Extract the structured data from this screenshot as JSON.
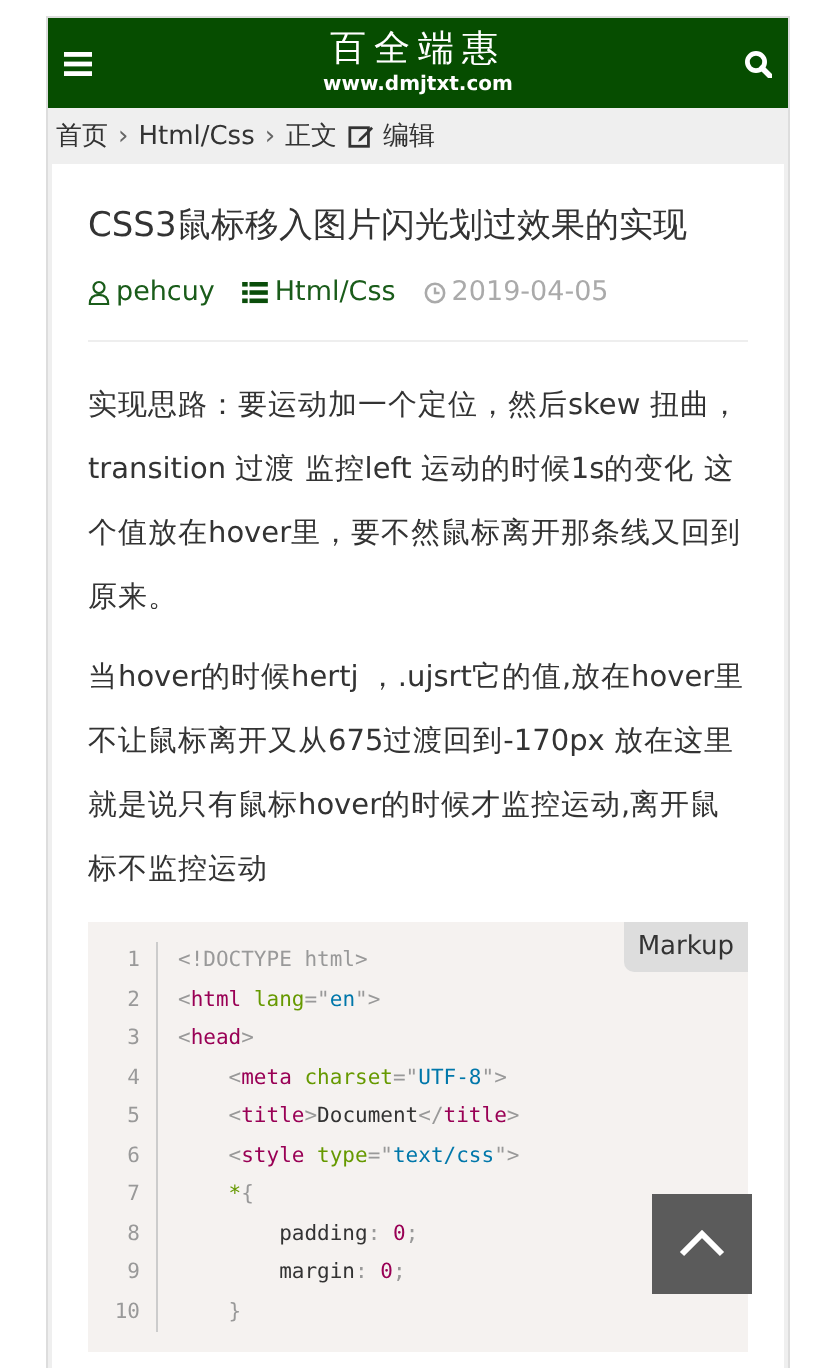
{
  "header": {
    "logo": "百全端惠",
    "domain": "www.dmjtxt.com"
  },
  "breadcrumb": [
    {
      "label": "首页",
      "kind": "link"
    },
    {
      "label": "›",
      "kind": "sep"
    },
    {
      "label": "Html/Css",
      "kind": "link"
    },
    {
      "label": "›",
      "kind": "sep"
    },
    {
      "label": "正文",
      "kind": "text"
    },
    {
      "label": "编辑",
      "kind": "edit"
    }
  ],
  "article": {
    "title": "CSS3鼠标移入图片闪光划过效果的实现",
    "meta": [
      {
        "kind": "author",
        "label": "pehcuy"
      },
      {
        "kind": "category",
        "label": "Html/Css"
      },
      {
        "kind": "date",
        "label": "2019-04-05"
      }
    ],
    "paragraphs": [
      "实现思路：要运动加一个定位，然后skew 扭曲，transition 过渡   监控left 运动的时候1s的变化  这个值放在hover里，要不然鼠标离开那条线又回到原来。",
      "当hover的时候hertj ，.ujsrt它的值,放在hover里不让鼠标离开又从675过渡回到-170px  放在这里就是说只有鼠标hover的时候才监控运动,离开鼠标不监控运动"
    ]
  },
  "code": {
    "language": "Markup",
    "lines": [
      {
        "number": "1",
        "tokens": [
          {
            "kind": "punct",
            "t": "<!DOCTYPE html>"
          }
        ]
      },
      {
        "number": "2",
        "tokens": [
          {
            "kind": "punct",
            "t": "<"
          },
          {
            "kind": "tag",
            "t": "html"
          },
          {
            "kind": "attr",
            "t": " lang"
          },
          {
            "kind": "punct",
            "t": "=\""
          },
          {
            "kind": "str",
            "t": "en"
          },
          {
            "kind": "punct",
            "t": "\">"
          }
        ]
      },
      {
        "number": "3",
        "tokens": [
          {
            "kind": "punct",
            "t": "<"
          },
          {
            "kind": "tag",
            "t": "head"
          },
          {
            "kind": "punct",
            "t": ">"
          }
        ]
      },
      {
        "number": "4",
        "tokens": [
          {
            "kind": "punct",
            "t": "    <"
          },
          {
            "kind": "tag",
            "t": "meta"
          },
          {
            "kind": "attr",
            "t": " charset"
          },
          {
            "kind": "punct",
            "t": "=\""
          },
          {
            "kind": "str",
            "t": "UTF-8"
          },
          {
            "kind": "punct",
            "t": "\">"
          }
        ]
      },
      {
        "number": "5",
        "tokens": [
          {
            "kind": "punct",
            "t": "    <"
          },
          {
            "kind": "tag",
            "t": "title"
          },
          {
            "kind": "punct",
            "t": ">"
          },
          {
            "kind": "plain",
            "t": "Document"
          },
          {
            "kind": "punct",
            "t": "</"
          },
          {
            "kind": "tag",
            "t": "title"
          },
          {
            "kind": "punct",
            "t": ">"
          }
        ]
      },
      {
        "number": "6",
        "tokens": [
          {
            "kind": "punct",
            "t": "    <"
          },
          {
            "kind": "tag",
            "t": "style"
          },
          {
            "kind": "attr",
            "t": " type"
          },
          {
            "kind": "punct",
            "t": "=\""
          },
          {
            "kind": "str",
            "t": "text/css"
          },
          {
            "kind": "punct",
            "t": "\">"
          }
        ]
      },
      {
        "number": "7",
        "tokens": [
          {
            "kind": "sel",
            "t": "    *"
          },
          {
            "kind": "punct",
            "t": "{"
          }
        ]
      },
      {
        "number": "8",
        "tokens": [
          {
            "kind": "plain",
            "t": "        padding"
          },
          {
            "kind": "punct",
            "t": ":"
          },
          {
            "kind": "num",
            "t": " 0"
          },
          {
            "kind": "punct",
            "t": ";"
          }
        ]
      },
      {
        "number": "9",
        "tokens": [
          {
            "kind": "plain",
            "t": "        margin"
          },
          {
            "kind": "punct",
            "t": ":"
          },
          {
            "kind": "num",
            "t": " 0"
          },
          {
            "kind": "punct",
            "t": ";"
          }
        ]
      },
      {
        "number": "10",
        "tokens": [
          {
            "kind": "punct",
            "t": "    }"
          }
        ]
      }
    ]
  }
}
